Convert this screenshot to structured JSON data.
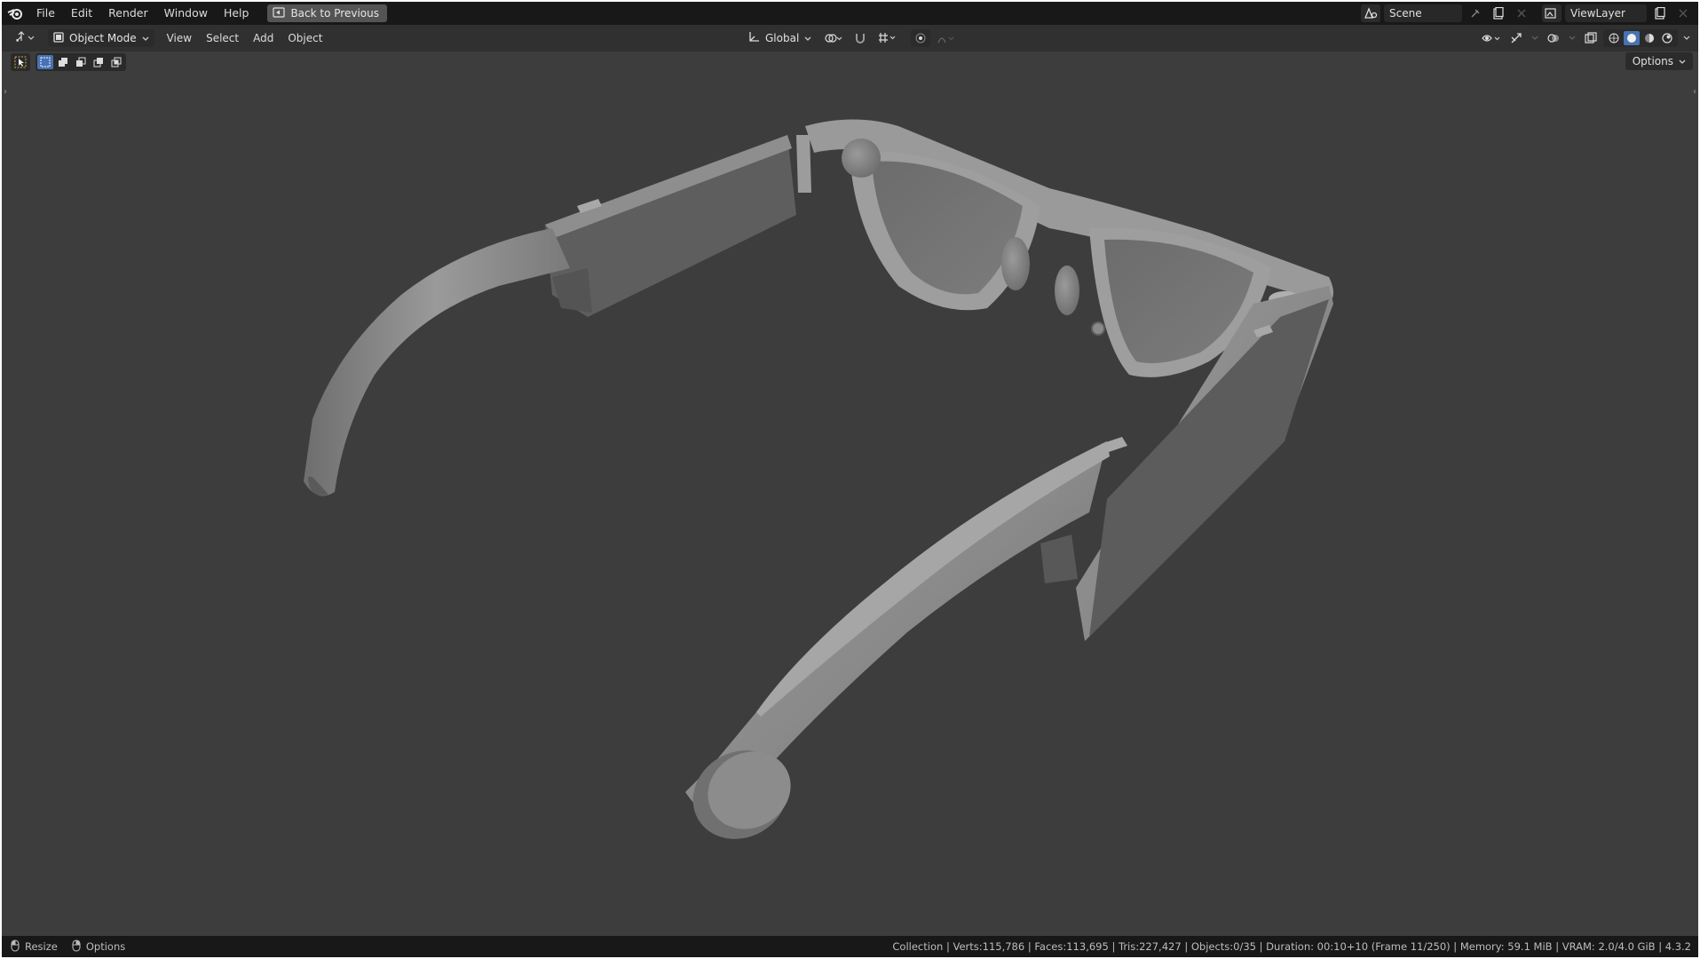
{
  "menu": {
    "file": "File",
    "edit": "Edit",
    "render": "Render",
    "window": "Window",
    "help": "Help",
    "back_to_previous": "Back to Previous"
  },
  "top_right": {
    "scene": "Scene",
    "view_layer": "ViewLayer"
  },
  "header": {
    "mode": "Object Mode",
    "view": "View",
    "select": "Select",
    "add": "Add",
    "object": "Object",
    "orientation": "Global"
  },
  "viewport": {
    "options": "Options"
  },
  "status": {
    "resize": "Resize",
    "options": "Options",
    "info": "Collection | Verts:115,786 | Faces:113,695 | Tris:227,427 | Objects:0/35 | Duration: 00:10+10 (Frame 11/250) | Memory: 59.1 MiB | VRAM: 2.0/4.0 GiB | 4.3.2"
  },
  "colors": {
    "viewport_bg": "#3d3d3d",
    "topbar_bg": "#181818",
    "header_bg": "#303030",
    "accent": "#4772b3",
    "model_gray": "#8a8a8a"
  }
}
